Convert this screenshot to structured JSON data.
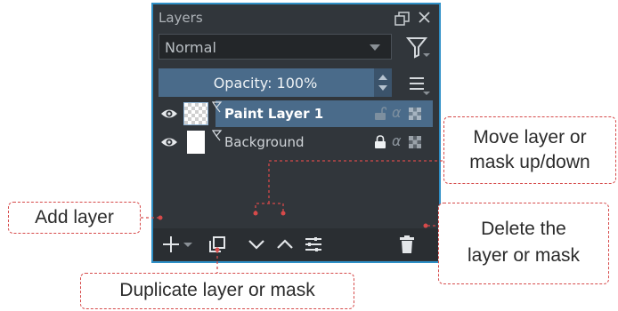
{
  "panel": {
    "title": "Layers",
    "blend_mode": "Normal",
    "opacity_label": "Opacity:  100%",
    "layers": [
      {
        "name": "Paint Layer 1",
        "selected": true,
        "thumbnail": "transparent-checker"
      },
      {
        "name": "Background",
        "selected": false,
        "thumbnail": "white"
      }
    ],
    "alpha_glyph": "α",
    "icons": {
      "float": "float-window-icon",
      "close": "close-icon",
      "filter": "filter-icon",
      "menu": "hamburger-menu-icon",
      "add": "plus-icon",
      "duplicate": "duplicate-icon",
      "move_down": "chevron-down-icon",
      "move_up": "chevron-up-icon",
      "properties": "properties-icon",
      "delete": "trash-icon"
    },
    "colors": {
      "panel_bg": "#31363b",
      "selection": "#4a6b8a",
      "focus_border": "#2f90c7"
    }
  },
  "callouts": {
    "add_layer": "Add layer",
    "duplicate": "Duplicate layer or mask",
    "move_line1": "Move layer or",
    "move_line2": "mask up/down",
    "delete_line1": "Delete the",
    "delete_line2": "layer or mask"
  },
  "callout_color": "#d64a4a"
}
